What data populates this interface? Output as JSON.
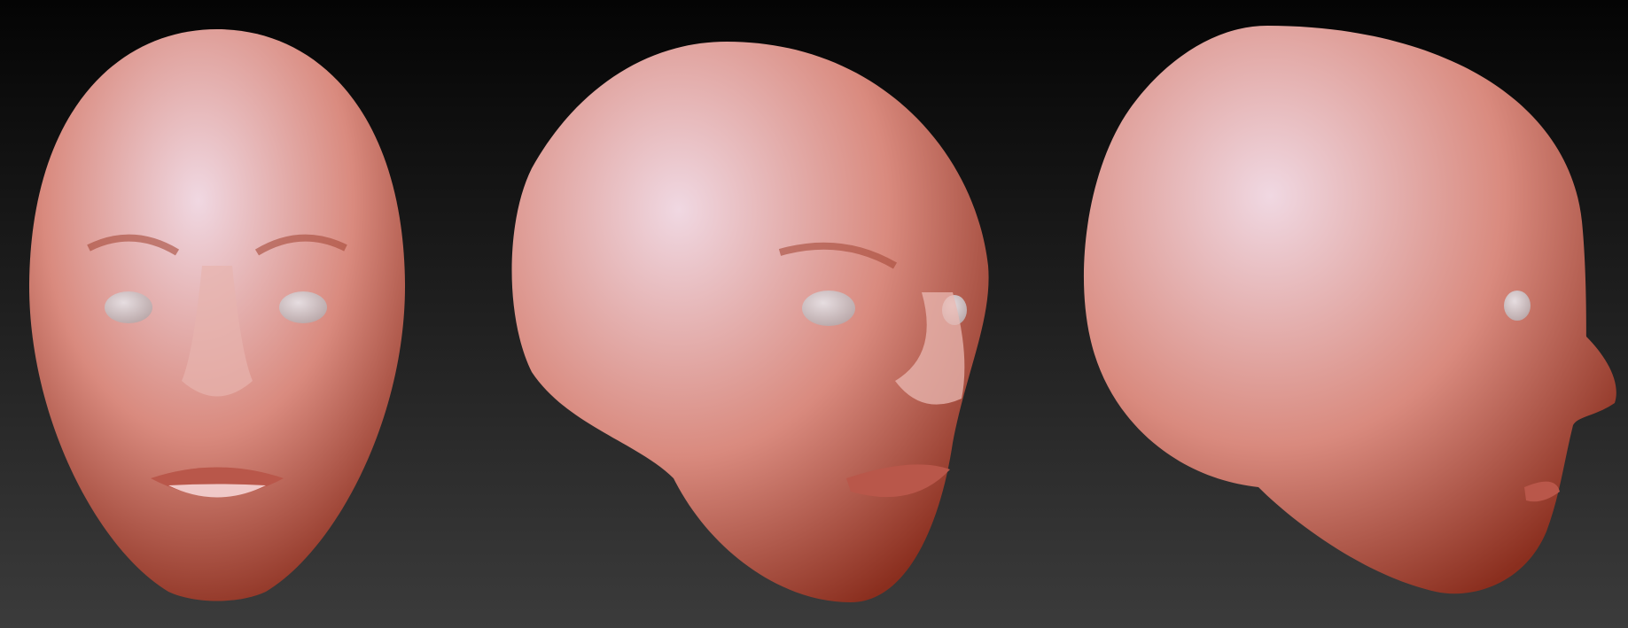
{
  "scene": {
    "views": [
      "front",
      "three-quarter",
      "profile"
    ],
    "colors": {
      "background_top": "#040404",
      "background_bottom": "#3b3b3b",
      "skin_highlight": "#f0d8e2",
      "skin_mid": "#d98a7e",
      "skin_shadow": "#8a2e1e",
      "eye": "#b9a7a8"
    }
  }
}
